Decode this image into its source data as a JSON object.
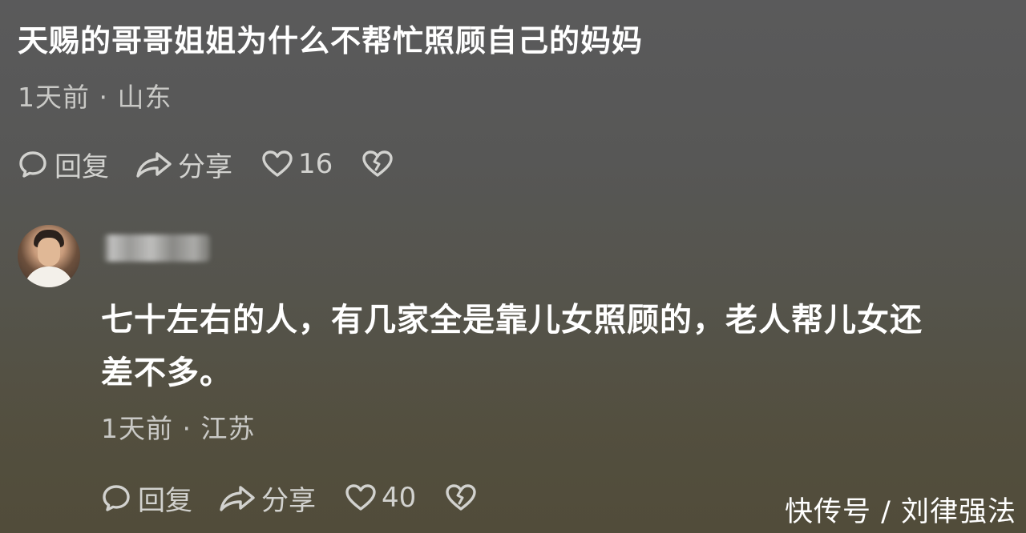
{
  "comment1": {
    "text": "天赐的哥哥姐姐为什么不帮忙照顾自己的妈妈",
    "time_location": "1天前 · 山东",
    "reply_label": "回复",
    "share_label": "分享",
    "like_count": "16"
  },
  "comment2": {
    "text_line1": "七十左右的人，有几家全是靠儿女照顾的，老人帮儿女还",
    "text_line2": "差不多。",
    "time_location": "1天前 · 江苏",
    "reply_label": "回复",
    "share_label": "分享",
    "like_count": "40"
  },
  "watermark": "快传号 / 刘律强法",
  "icons": {
    "reply": "chat-bubble-icon",
    "share": "share-arrow-icon",
    "like": "heart-outline-icon",
    "dislike": "broken-heart-icon",
    "avatar": "user-avatar"
  },
  "colors": {
    "text_primary": "#ffffff",
    "text_secondary": "#c9c9c6",
    "action_color": "#d2d2cf"
  }
}
